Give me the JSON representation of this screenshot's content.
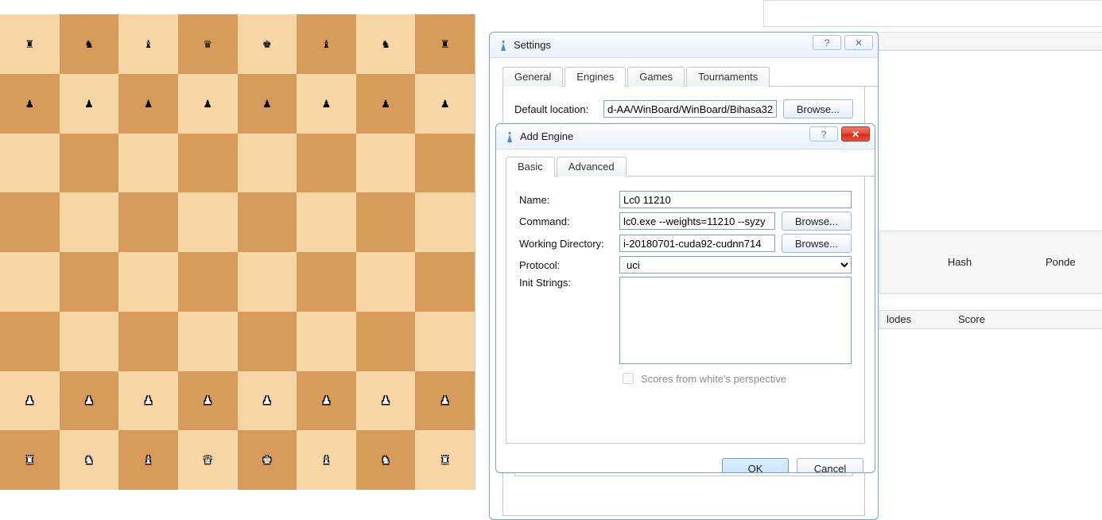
{
  "board": {
    "rows": [
      [
        "r",
        "n",
        "b",
        "q",
        "k",
        "b",
        "n",
        "r"
      ],
      [
        "p",
        "p",
        "p",
        "p",
        "p",
        "p",
        "p",
        "p"
      ],
      [
        "",
        "",
        "",
        "",
        "",
        "",
        "",
        ""
      ],
      [
        "",
        "",
        "",
        "",
        "",
        "",
        "",
        ""
      ],
      [
        "",
        "",
        "",
        "",
        "",
        "",
        "",
        ""
      ],
      [
        "",
        "",
        "",
        "",
        "",
        "",
        "",
        ""
      ],
      [
        "P",
        "P",
        "P",
        "P",
        "P",
        "P",
        "P",
        "P"
      ],
      [
        "R",
        "N",
        "B",
        "Q",
        "K",
        "B",
        "N",
        "R"
      ]
    ]
  },
  "piece_glyphs": {
    "K": "♔",
    "Q": "♕",
    "R": "♖",
    "B": "♗",
    "N": "♘",
    "P": "♙",
    "k": "♚",
    "q": "♛",
    "r": "♜",
    "b": "♝",
    "n": "♞",
    "p": "♟"
  },
  "bg": {
    "panel1_cols": [
      "lodes",
      "Score"
    ],
    "panel2_cols": [
      "Hash",
      "Ponde"
    ],
    "panel3_cols": [
      "lodes",
      "Score"
    ]
  },
  "settings": {
    "title": "Settings",
    "tabs": {
      "general": "General",
      "engines": "Engines",
      "games": "Games",
      "tournaments": "Tournaments"
    },
    "default_location_label": "Default location:",
    "default_location_value": "d-AA/WinBoard/WinBoard/Bihasa32",
    "browse": "Browse..."
  },
  "add_engine": {
    "title": "Add Engine",
    "tabs": {
      "basic": "Basic",
      "advanced": "Advanced"
    },
    "labels": {
      "name": "Name:",
      "command": "Command:",
      "wd": "Working Directory:",
      "protocol": "Protocol:",
      "init": "Init Strings:",
      "scores": "Scores from white's perspective"
    },
    "values": {
      "name": "Lc0 11210",
      "command": "lc0.exe --weights=11210 --syzy",
      "wd": "i-20180701-cuda92-cudnn714",
      "protocol": "uci",
      "init": ""
    },
    "browse": "Browse...",
    "ok": "OK",
    "cancel": "Cancel"
  }
}
